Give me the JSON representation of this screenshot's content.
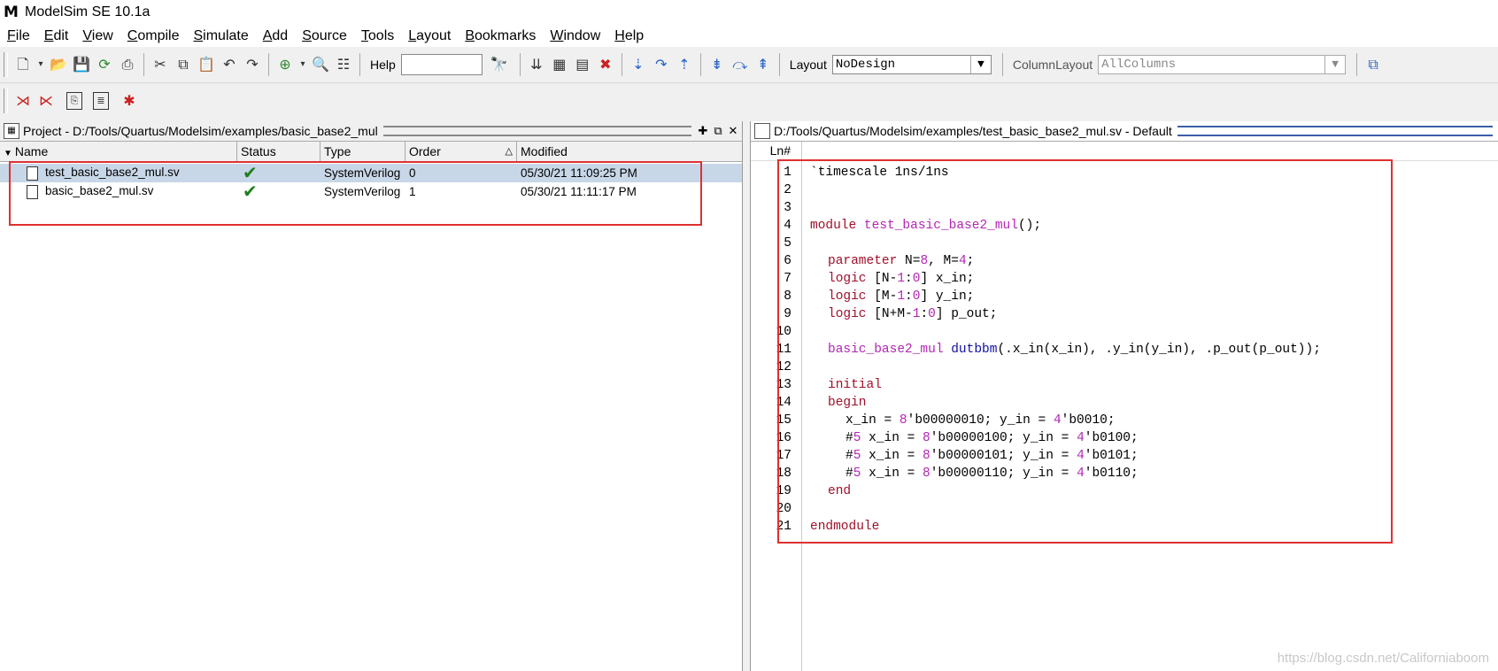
{
  "window": {
    "title": "ModelSim SE 10.1a",
    "logo": "M"
  },
  "menu": [
    {
      "label": "File"
    },
    {
      "label": "Edit"
    },
    {
      "label": "View"
    },
    {
      "label": "Compile"
    },
    {
      "label": "Simulate"
    },
    {
      "label": "Add"
    },
    {
      "label": "Source"
    },
    {
      "label": "Tools"
    },
    {
      "label": "Layout"
    },
    {
      "label": "Bookmarks"
    },
    {
      "label": "Window"
    },
    {
      "label": "Help"
    }
  ],
  "toolbar": {
    "help_label": "Help",
    "help_value": "",
    "layout_label": "Layout",
    "layout_value": "NoDesign",
    "column_layout_label": "ColumnLayout",
    "column_layout_value": "AllColumns"
  },
  "project": {
    "title": "Project - D:/Tools/Quartus/Modelsim/examples/basic_base2_mul",
    "columns": [
      "Name",
      "Status",
      "Type",
      "Order",
      "Modified"
    ],
    "rows": [
      {
        "name": "test_basic_base2_mul.sv",
        "status": "✔",
        "type": "SystemVerilog",
        "order": "0",
        "modified": "05/30/21 11:09:25 PM"
      },
      {
        "name": "basic_base2_mul.sv",
        "status": "✔",
        "type": "SystemVerilog",
        "order": "1",
        "modified": "05/30/21 11:11:17 PM"
      }
    ]
  },
  "editor": {
    "title": "D:/Tools/Quartus/Modelsim/examples/test_basic_base2_mul.sv - Default",
    "ln_header": "Ln#",
    "lines": [
      {
        "n": "1"
      },
      {
        "n": "2"
      },
      {
        "n": "3"
      },
      {
        "n": "4"
      },
      {
        "n": "5"
      },
      {
        "n": "6"
      },
      {
        "n": "7"
      },
      {
        "n": "8"
      },
      {
        "n": "9"
      },
      {
        "n": "10"
      },
      {
        "n": "11"
      },
      {
        "n": "12"
      },
      {
        "n": "13"
      },
      {
        "n": "14"
      },
      {
        "n": "15"
      },
      {
        "n": "16"
      },
      {
        "n": "17"
      },
      {
        "n": "18"
      },
      {
        "n": "19"
      },
      {
        "n": "20"
      },
      {
        "n": "21"
      }
    ],
    "code": {
      "l1": "`timescale 1ns/1ns",
      "l4a": "module",
      "l4b": "test_basic_base2_mul",
      "l4c": "();",
      "l6a": "parameter",
      "l6b": " N=",
      "l6c": "8",
      "l6d": ", M=",
      "l6e": "4",
      "l6f": ";",
      "l7a": "logic",
      "l7b": " [N-",
      "l7c": "1",
      "l7d": ":",
      "l7e": "0",
      "l7f": "] x_in;",
      "l8a": "logic",
      "l8b": " [M-",
      "l8c": "1",
      "l8d": ":",
      "l8e": "0",
      "l8f": "] y_in;",
      "l9a": "logic",
      "l9b": " [N+M-",
      "l9c": "1",
      "l9d": ":",
      "l9e": "0",
      "l9f": "] p_out;",
      "l11a": "basic_base2_mul",
      "l11b": " dutbbm",
      "l11c": "(.x_in(x_in), .y_in(y_in), .p_out(p_out));",
      "l13": "initial",
      "l14": "begin",
      "l15a": "x_in = ",
      "l15b": "8",
      "l15c": "'b00000010; y_in = ",
      "l15d": "4",
      "l15e": "'b0010;",
      "l16a": "#",
      "l16b": "5",
      "l16c": " x_in = ",
      "l16d": "8",
      "l16e": "'b00000100; y_in = ",
      "l16f": "4",
      "l16g": "'b0100;",
      "l17a": "#",
      "l17b": "5",
      "l17c": " x_in = ",
      "l17d": "8",
      "l17e": "'b00000101; y_in = ",
      "l17f": "4",
      "l17g": "'b0101;",
      "l18a": "#",
      "l18b": "5",
      "l18c": " x_in = ",
      "l18d": "8",
      "l18e": "'b00000110; y_in = ",
      "l18f": "4",
      "l18g": "'b0110;",
      "l19": "end",
      "l21": "endmodule"
    }
  },
  "watermark": "https://blog.csdn.net/Californiaboom",
  "colors": {
    "highlight_box": "#e03030",
    "selected_row": "#c8d7e8",
    "keyword": "#a0102a",
    "module_name": "#b326b3"
  }
}
